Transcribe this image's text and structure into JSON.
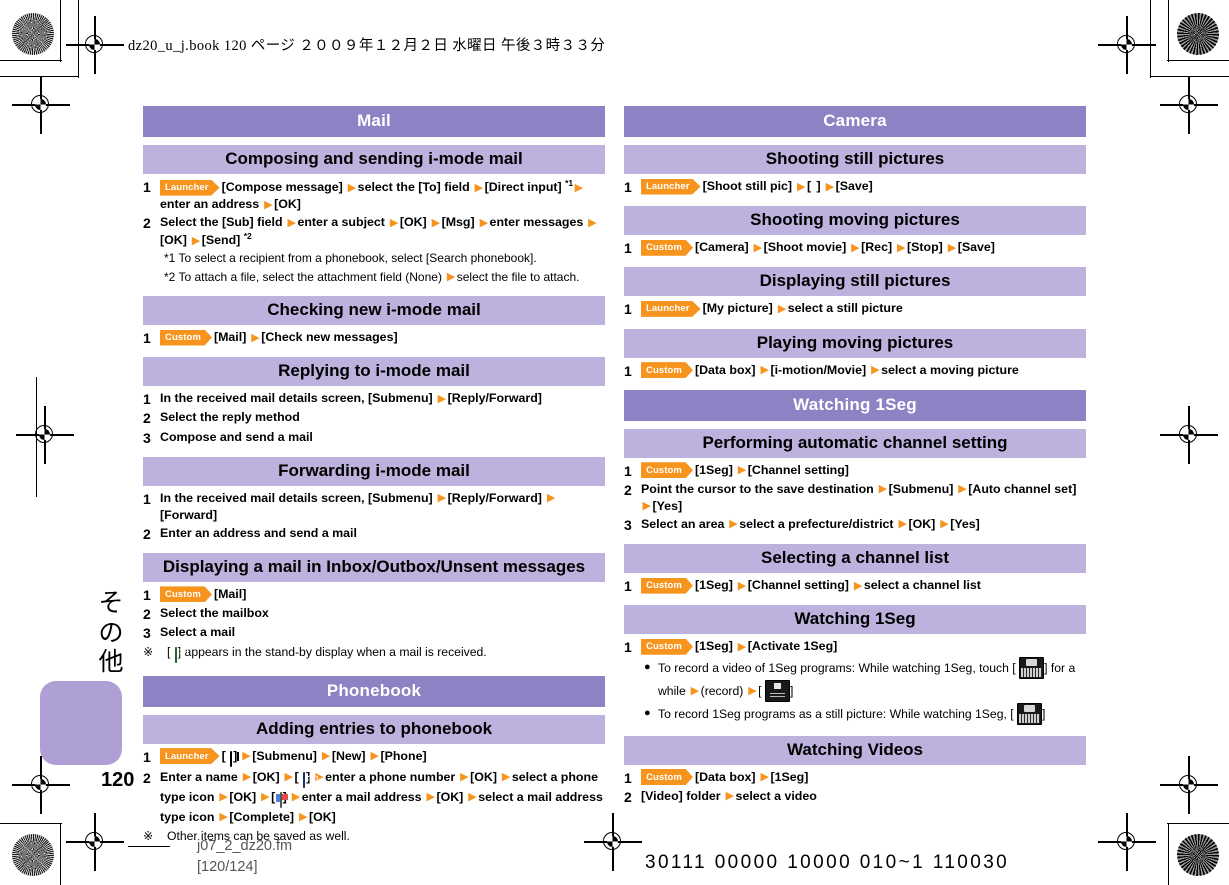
{
  "print_header": "dz20_u_j.book   120 ページ   ２００９年１２月２日   水曜日   午後３時３３分",
  "footer": {
    "filename": "j07_2_dz20.fm",
    "pagerange": "[120/124]",
    "code": "30111 00000 10000 010~1 110030"
  },
  "page_number": "120",
  "side_tab_label": "その他",
  "badges": {
    "launcher": "Launcher",
    "custom": "Custom"
  },
  "left_column": [
    {
      "type": "section",
      "title": "Mail"
    },
    {
      "type": "subsection",
      "title": "Composing and sending i-mode mail"
    },
    {
      "type": "step",
      "num": "1",
      "parts": [
        {
          "k": "badge",
          "v": "Launcher"
        },
        {
          "k": "t",
          "v": "[Compose message]"
        },
        {
          "k": "arrow"
        },
        {
          "k": "t",
          "v": "select the [To] field"
        },
        {
          "k": "arrow"
        },
        {
          "k": "t",
          "v": "[Direct input]"
        },
        {
          "k": "sup",
          "v": "*1"
        },
        {
          "k": "arrow"
        },
        {
          "k": "t",
          "v": "enter an address"
        },
        {
          "k": "arrow"
        },
        {
          "k": "t",
          "v": "[OK]"
        }
      ]
    },
    {
      "type": "step",
      "num": "2",
      "parts": [
        {
          "k": "t",
          "v": "Select the [Sub] field"
        },
        {
          "k": "arrow"
        },
        {
          "k": "t",
          "v": "enter a subject"
        },
        {
          "k": "arrow"
        },
        {
          "k": "t",
          "v": "[OK]"
        },
        {
          "k": "arrow"
        },
        {
          "k": "t",
          "v": "[Msg]"
        },
        {
          "k": "arrow"
        },
        {
          "k": "t",
          "v": "enter messages"
        },
        {
          "k": "arrow"
        },
        {
          "k": "t",
          "v": "[OK]"
        },
        {
          "k": "arrow"
        },
        {
          "k": "t",
          "v": "[Send]"
        },
        {
          "k": "sup",
          "v": "*2"
        }
      ]
    },
    {
      "type": "footnote",
      "parts": [
        {
          "k": "t",
          "v": "*1  To select a recipient from a phonebook, select [Search phonebook]."
        }
      ]
    },
    {
      "type": "footnote",
      "parts": [
        {
          "k": "t",
          "v": "*2  To attach a file, select the attachment field (None)"
        },
        {
          "k": "arrow"
        },
        {
          "k": "t",
          "v": "select the file to attach."
        }
      ]
    },
    {
      "type": "subsection",
      "title": "Checking new i-mode mail"
    },
    {
      "type": "step",
      "num": "1",
      "parts": [
        {
          "k": "badge",
          "v": "Custom"
        },
        {
          "k": "t",
          "v": "[Mail]"
        },
        {
          "k": "arrow"
        },
        {
          "k": "t",
          "v": "[Check new messages]"
        }
      ]
    },
    {
      "type": "subsection",
      "title": "Replying to i-mode mail"
    },
    {
      "type": "step",
      "num": "1",
      "parts": [
        {
          "k": "t",
          "v": "In the received mail details screen, [Submenu]"
        },
        {
          "k": "arrow"
        },
        {
          "k": "t",
          "v": "[Reply/Forward]"
        }
      ]
    },
    {
      "type": "step",
      "num": "2",
      "parts": [
        {
          "k": "t",
          "v": "Select the reply method"
        }
      ]
    },
    {
      "type": "step",
      "num": "3",
      "parts": [
        {
          "k": "t",
          "v": "Compose and send a mail"
        }
      ]
    },
    {
      "type": "subsection",
      "title": "Forwarding i-mode mail"
    },
    {
      "type": "step",
      "num": "1",
      "parts": [
        {
          "k": "t",
          "v": "In the received mail details screen, [Submenu]"
        },
        {
          "k": "arrow"
        },
        {
          "k": "t",
          "v": "[Reply/Forward]"
        },
        {
          "k": "arrow"
        },
        {
          "k": "t",
          "v": "[Forward]"
        }
      ]
    },
    {
      "type": "step",
      "num": "2",
      "parts": [
        {
          "k": "t",
          "v": "Enter an address and send a mail"
        }
      ]
    },
    {
      "type": "subsection",
      "title": "Displaying a mail in Inbox/Outbox/Unsent messages"
    },
    {
      "type": "step",
      "num": "1",
      "parts": [
        {
          "k": "badge",
          "v": "Custom"
        },
        {
          "k": "t",
          "v": "[Mail]"
        }
      ]
    },
    {
      "type": "step",
      "num": "2",
      "parts": [
        {
          "k": "t",
          "v": "Select the mailbox"
        }
      ]
    },
    {
      "type": "step",
      "num": "3",
      "parts": [
        {
          "k": "t",
          "v": "Select a mail"
        }
      ]
    },
    {
      "type": "note",
      "mark": "※",
      "parts": [
        {
          "k": "t",
          "v": "["
        },
        {
          "k": "icon",
          "v": "mail-received-icon"
        },
        {
          "k": "t",
          "v": "] appears in the stand-by display when a mail is received."
        }
      ]
    },
    {
      "type": "section",
      "title": "Phonebook"
    },
    {
      "type": "subsection",
      "title": "Adding entries to phonebook"
    },
    {
      "type": "step",
      "num": "1",
      "parts": [
        {
          "k": "badge",
          "v": "Launcher"
        },
        {
          "k": "t",
          "v": "["
        },
        {
          "k": "icon",
          "v": "phonebook-icon"
        },
        {
          "k": "t",
          "v": "]"
        },
        {
          "k": "arrow"
        },
        {
          "k": "t",
          "v": "[Submenu]"
        },
        {
          "k": "arrow"
        },
        {
          "k": "t",
          "v": "[New]"
        },
        {
          "k": "arrow"
        },
        {
          "k": "t",
          "v": "[Phone]"
        }
      ]
    },
    {
      "type": "step",
      "num": "2",
      "parts": [
        {
          "k": "t",
          "v": "Enter a name"
        },
        {
          "k": "arrow"
        },
        {
          "k": "t",
          "v": "[OK]"
        },
        {
          "k": "arrow"
        },
        {
          "k": "t",
          "v": "["
        },
        {
          "k": "icon",
          "v": "telephone-icon"
        },
        {
          "k": "t",
          "v": "]"
        },
        {
          "k": "arrow"
        },
        {
          "k": "t",
          "v": "enter a phone number"
        },
        {
          "k": "arrow"
        },
        {
          "k": "t",
          "v": "[OK]"
        },
        {
          "k": "arrow"
        },
        {
          "k": "t",
          "v": "select a phone type icon"
        },
        {
          "k": "arrow"
        },
        {
          "k": "t",
          "v": "[OK]"
        },
        {
          "k": "arrow"
        },
        {
          "k": "t",
          "v": "["
        },
        {
          "k": "icon",
          "v": "mail-address-icon"
        },
        {
          "k": "t",
          "v": "]"
        },
        {
          "k": "arrow"
        },
        {
          "k": "t",
          "v": "enter a mail address"
        },
        {
          "k": "arrow"
        },
        {
          "k": "t",
          "v": "[OK]"
        },
        {
          "k": "arrow"
        },
        {
          "k": "t",
          "v": "select a mail address type icon"
        },
        {
          "k": "arrow"
        },
        {
          "k": "t",
          "v": "[Complete]"
        },
        {
          "k": "arrow"
        },
        {
          "k": "t",
          "v": "[OK]"
        }
      ]
    },
    {
      "type": "note",
      "mark": "※",
      "parts": [
        {
          "k": "t",
          "v": "Other items can be saved as well."
        }
      ]
    }
  ],
  "right_column": [
    {
      "type": "section",
      "title": "Camera"
    },
    {
      "type": "subsection",
      "title": "Shooting still pictures"
    },
    {
      "type": "step",
      "num": "1",
      "parts": [
        {
          "k": "badge",
          "v": "Launcher"
        },
        {
          "k": "t",
          "v": "[Shoot still pic]"
        },
        {
          "k": "arrow"
        },
        {
          "k": "t",
          "v": "["
        },
        {
          "k": "icon",
          "v": "camera-shutter-icon"
        },
        {
          "k": "t",
          "v": "]"
        },
        {
          "k": "arrow"
        },
        {
          "k": "t",
          "v": "[Save]"
        }
      ]
    },
    {
      "type": "subsection",
      "title": "Shooting moving pictures"
    },
    {
      "type": "step",
      "num": "1",
      "parts": [
        {
          "k": "badge",
          "v": "Custom"
        },
        {
          "k": "t",
          "v": "[Camera]"
        },
        {
          "k": "arrow"
        },
        {
          "k": "t",
          "v": "[Shoot movie]"
        },
        {
          "k": "arrow"
        },
        {
          "k": "t",
          "v": "[Rec]"
        },
        {
          "k": "arrow"
        },
        {
          "k": "t",
          "v": "[Stop]"
        },
        {
          "k": "arrow"
        },
        {
          "k": "t",
          "v": "[Save]"
        }
      ]
    },
    {
      "type": "subsection",
      "title": "Displaying still pictures"
    },
    {
      "type": "step",
      "num": "1",
      "parts": [
        {
          "k": "badge",
          "v": "Launcher"
        },
        {
          "k": "t",
          "v": "[My picture]"
        },
        {
          "k": "arrow"
        },
        {
          "k": "t",
          "v": "select a still picture"
        }
      ]
    },
    {
      "type": "subsection",
      "title": "Playing moving pictures"
    },
    {
      "type": "step",
      "num": "1",
      "parts": [
        {
          "k": "badge",
          "v": "Custom"
        },
        {
          "k": "t",
          "v": "[Data box]"
        },
        {
          "k": "arrow"
        },
        {
          "k": "t",
          "v": "[i-motion/Movie]"
        },
        {
          "k": "arrow"
        },
        {
          "k": "t",
          "v": "select a moving picture"
        }
      ]
    },
    {
      "type": "section",
      "title": "Watching 1Seg"
    },
    {
      "type": "subsection",
      "title": "Performing automatic channel setting"
    },
    {
      "type": "step",
      "num": "1",
      "parts": [
        {
          "k": "badge",
          "v": "Custom"
        },
        {
          "k": "t",
          "v": "[1Seg]"
        },
        {
          "k": "arrow"
        },
        {
          "k": "t",
          "v": "[Channel setting]"
        }
      ]
    },
    {
      "type": "step",
      "num": "2",
      "parts": [
        {
          "k": "t",
          "v": "Point the cursor to the save destination"
        },
        {
          "k": "arrow"
        },
        {
          "k": "t",
          "v": "[Submenu]"
        },
        {
          "k": "arrow"
        },
        {
          "k": "t",
          "v": "[Auto channel set]"
        },
        {
          "k": "arrow"
        },
        {
          "k": "t",
          "v": "[Yes]"
        }
      ]
    },
    {
      "type": "step",
      "num": "3",
      "parts": [
        {
          "k": "t",
          "v": "Select an area"
        },
        {
          "k": "arrow"
        },
        {
          "k": "t",
          "v": "select a prefecture/district"
        },
        {
          "k": "arrow"
        },
        {
          "k": "t",
          "v": "[OK]"
        },
        {
          "k": "arrow"
        },
        {
          "k": "t",
          "v": "[Yes]"
        }
      ]
    },
    {
      "type": "subsection",
      "title": "Selecting a channel list"
    },
    {
      "type": "step",
      "num": "1",
      "parts": [
        {
          "k": "badge",
          "v": "Custom"
        },
        {
          "k": "t",
          "v": "[1Seg]"
        },
        {
          "k": "arrow"
        },
        {
          "k": "t",
          "v": "[Channel setting]"
        },
        {
          "k": "arrow"
        },
        {
          "k": "t",
          "v": "select a channel list"
        }
      ]
    },
    {
      "type": "subsection",
      "title": "Watching 1Seg"
    },
    {
      "type": "step",
      "num": "1",
      "parts": [
        {
          "k": "badge",
          "v": "Custom"
        },
        {
          "k": "t",
          "v": "[1Seg]"
        },
        {
          "k": "arrow"
        },
        {
          "k": "t",
          "v": "[Activate 1Seg]"
        }
      ]
    },
    {
      "type": "bullet",
      "parts": [
        {
          "k": "t",
          "v": "To record a video of 1Seg programs: While watching 1Seg, touch ["
        },
        {
          "k": "keyicon",
          "v": "record-key-icon"
        },
        {
          "k": "t",
          "v": "] for a while"
        },
        {
          "k": "arrow"
        },
        {
          "k": "t",
          "v": "(record)"
        },
        {
          "k": "arrow"
        },
        {
          "k": "t",
          "v": "["
        },
        {
          "k": "keyicon-stop",
          "v": "stop-key-icon"
        },
        {
          "k": "t",
          "v": "]"
        }
      ]
    },
    {
      "type": "bullet",
      "parts": [
        {
          "k": "t",
          "v": "To record 1Seg programs as a still picture: While watching 1Seg, ["
        },
        {
          "k": "keyicon",
          "v": "capture-key-icon"
        },
        {
          "k": "t",
          "v": "]"
        }
      ]
    },
    {
      "type": "subsection",
      "title": "Watching Videos"
    },
    {
      "type": "step",
      "num": "1",
      "parts": [
        {
          "k": "badge",
          "v": "Custom"
        },
        {
          "k": "t",
          "v": "[Data box]"
        },
        {
          "k": "arrow"
        },
        {
          "k": "t",
          "v": "[1Seg]"
        }
      ]
    },
    {
      "type": "step",
      "num": "2",
      "parts": [
        {
          "k": "t",
          "v": "[Video] folder"
        },
        {
          "k": "arrow"
        },
        {
          "k": "t",
          "v": "select a video"
        }
      ]
    }
  ]
}
